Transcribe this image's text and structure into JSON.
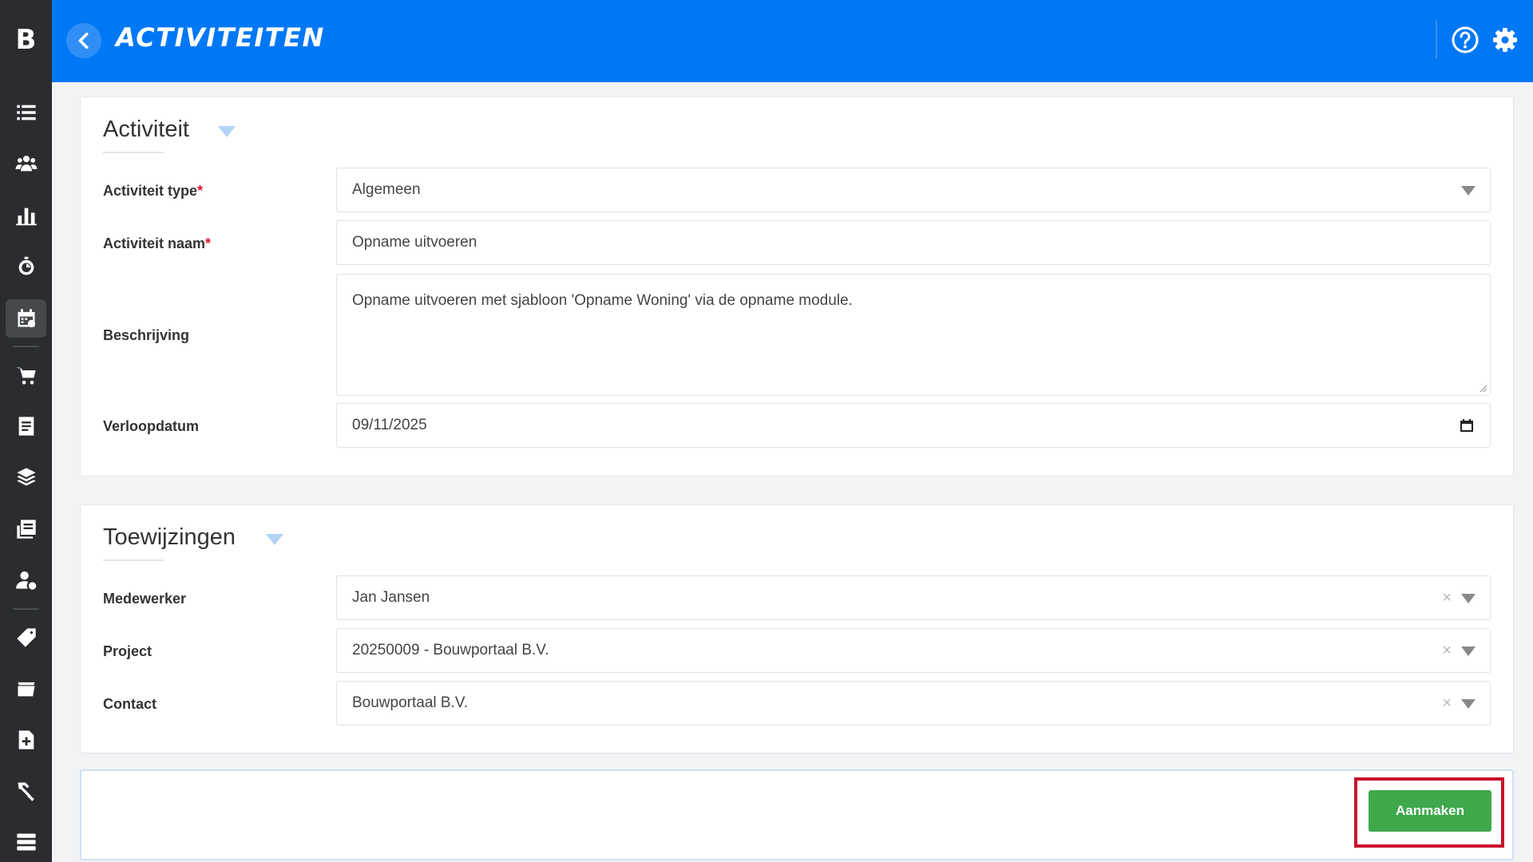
{
  "app": {
    "logo_letter": "B"
  },
  "header": {
    "title": "ACTIVITEITEN"
  },
  "sidebar": {
    "items": [
      {
        "icon": "list-icon"
      },
      {
        "icon": "users-icon"
      },
      {
        "icon": "bar-chart-icon"
      },
      {
        "icon": "stopwatch-icon"
      },
      {
        "icon": "calendar-icon",
        "active": true
      },
      {
        "icon": "cart-icon"
      },
      {
        "icon": "document-icon"
      },
      {
        "icon": "layers-icon"
      },
      {
        "icon": "reports-icon"
      },
      {
        "icon": "user-settings-icon"
      },
      {
        "icon": "tag-icon"
      },
      {
        "icon": "archive-icon"
      },
      {
        "icon": "file-plus-icon"
      },
      {
        "icon": "tools-icon"
      },
      {
        "icon": "server-icon"
      }
    ]
  },
  "activiteit": {
    "section_title": "Activiteit",
    "type_label": "Activiteit type",
    "type_value": "Algemeen",
    "naam_label": "Activiteit naam",
    "naam_value": "Opname uitvoeren",
    "beschrijving_label": "Beschrijving",
    "beschrijving_value": "Opname uitvoeren met sjabloon 'Opname Woning' via de opname module.",
    "verloopdatum_label": "Verloopdatum",
    "verloopdatum_value": "09/11/2025",
    "required_mark": "*"
  },
  "toewijzingen": {
    "section_title": "Toewijzingen",
    "medewerker_label": "Medewerker",
    "medewerker_value": "Jan Jansen",
    "project_label": "Project",
    "project_value": "20250009 - Bouwportaal B.V.",
    "contact_label": "Contact",
    "contact_value": "Bouwportaal B.V.",
    "clear_symbol": "×"
  },
  "footer": {
    "create_label": "Aanmaken"
  },
  "colors": {
    "primary": "#0078f5",
    "sidebar": "#2a2c2f",
    "success": "#3fa84b",
    "required": "#e0102f",
    "highlight": "#c8102e"
  }
}
